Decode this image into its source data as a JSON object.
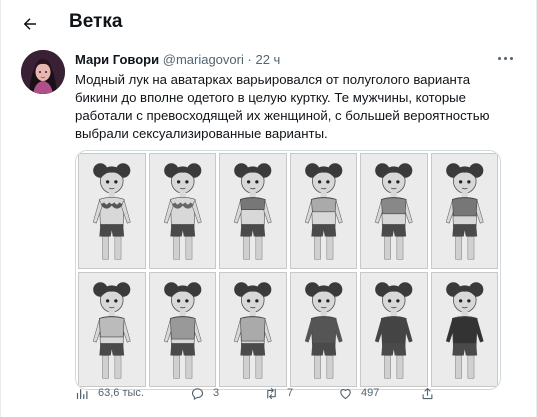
{
  "header": {
    "title": "Ветка",
    "back_icon": "arrow-left-icon"
  },
  "tweet": {
    "author_name": "Мари Говори",
    "author_handle": "@mariagovori",
    "separator": "·",
    "time": "22 ч",
    "text_lines": [
      "Модный лук на аватарках варьировался от полуголого варианта",
      "бикини до вполне одетого в целую куртку. Те мужчины, которые",
      "работали с превосходящей их женщиной, с большей вероятностью",
      "выбрали сексуализированные варианты."
    ],
    "media": {
      "description_icon": "image-grid",
      "rows": 2,
      "cols": 6
    },
    "stats": {
      "views": "63,6 тыс.",
      "replies": "3",
      "retweets": "7",
      "likes": "497"
    }
  },
  "colors": {
    "text": "#0f1419",
    "secondary": "#536471",
    "border": "#cfd9de"
  }
}
